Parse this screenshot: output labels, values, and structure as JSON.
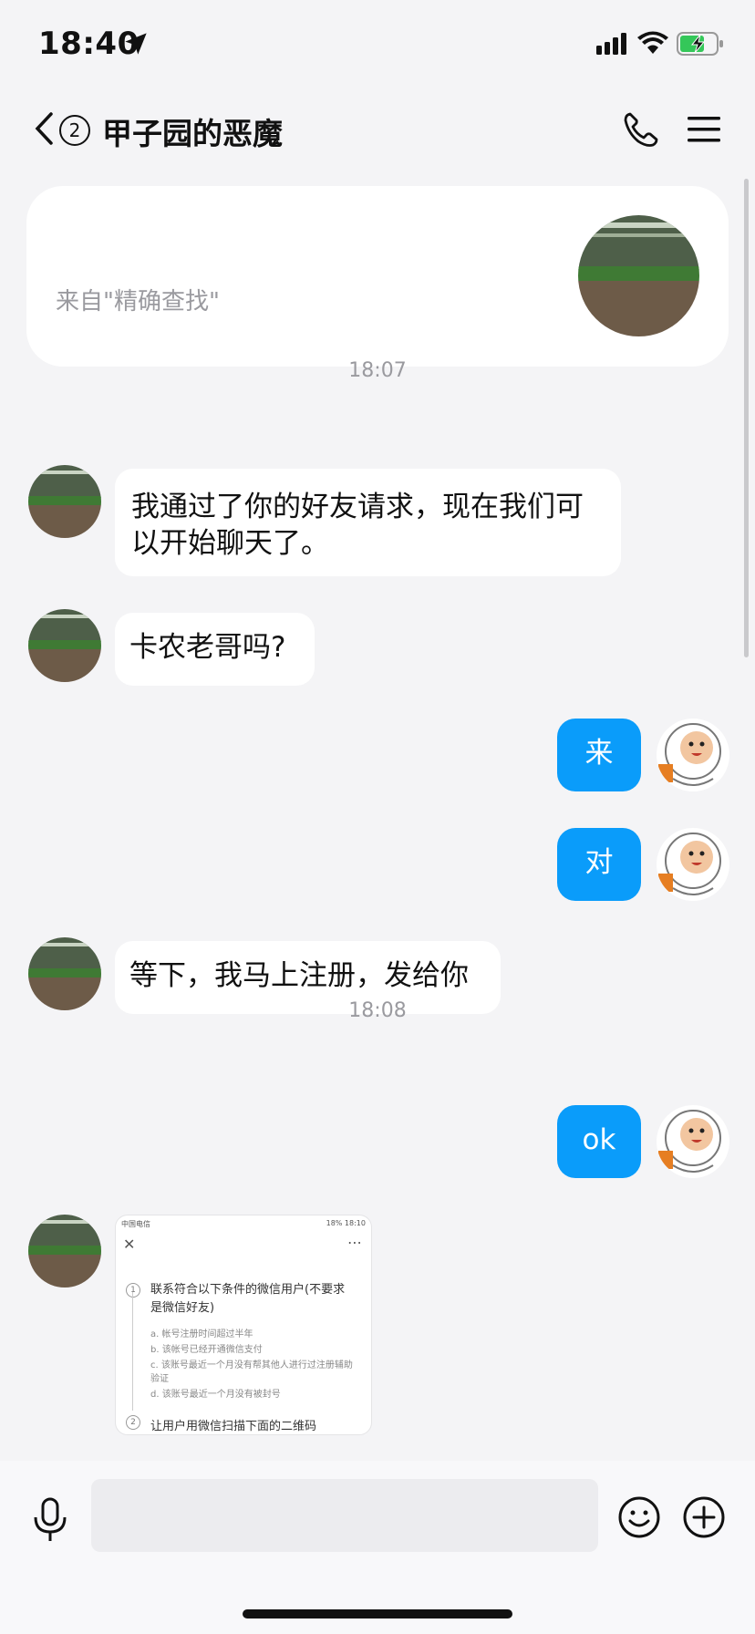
{
  "status_bar": {
    "time": "18:40"
  },
  "header": {
    "unread_count": "2",
    "title": "甲子园的恶魔"
  },
  "profile_card": {
    "source_text": "来自\"精确查找\""
  },
  "timestamps": [
    "18:07",
    "18:08"
  ],
  "messages": [
    {
      "from": "them",
      "text": "我通过了你的好友请求，现在我们可以开始聊天了。"
    },
    {
      "from": "them",
      "text": "卡农老哥吗?"
    },
    {
      "from": "me",
      "text": "来"
    },
    {
      "from": "me",
      "text": "对"
    },
    {
      "from": "them",
      "text": "等下，我马上注册，发给你"
    },
    {
      "from": "me",
      "text": "ok"
    }
  ],
  "image_message": {
    "status_left": "中国电信",
    "status_right": "18% 18:10",
    "step1": "联系符合以下条件的微信用户(不要求是微信好友)",
    "conditions": [
      "a. 帐号注册时间超过半年",
      "b. 该帐号已经开通微信支付",
      "c. 该账号最近一个月没有帮其他人进行过注册辅助验证",
      "d. 该账号最近一个月没有被封号"
    ],
    "step2": "让用户用微信扫描下面的二维码"
  },
  "colors": {
    "bubble_me": "#0a9cfa",
    "bubble_them": "#ffffff",
    "background": "#f4f4f6"
  }
}
